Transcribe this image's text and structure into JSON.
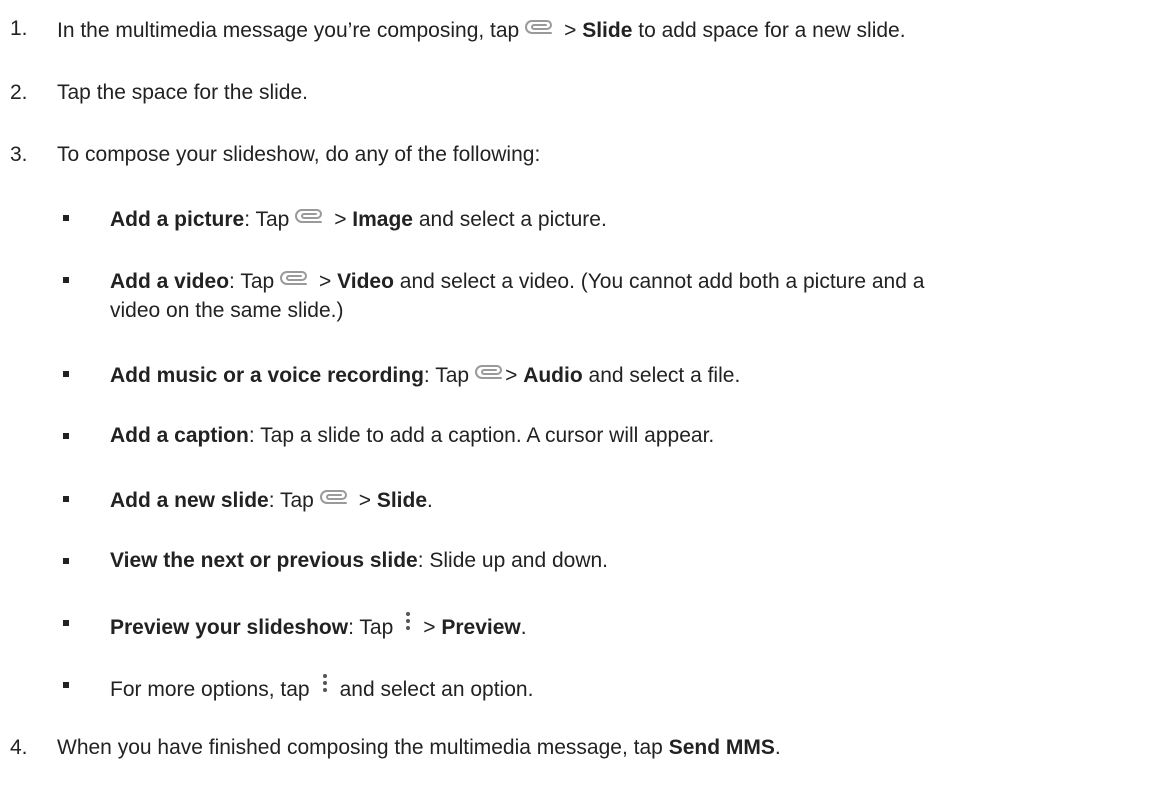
{
  "steps": [
    {
      "number": "1.",
      "pre": "In the multimedia message you’re composing, tap",
      "post": ">",
      "bold": "Slide",
      "tail": "to add space for a new slide.",
      "icon": "paperclip-icon"
    },
    {
      "number": "2.",
      "text": "Tap the space for the slide."
    },
    {
      "number": "3.",
      "text": "To compose your slideshow, do any of the following:"
    },
    {
      "number": "4.",
      "pre": "When you have finished composing the multimedia message, tap",
      "bold": "Send MMS",
      "tail": "."
    }
  ],
  "bullets": {
    "picture": {
      "label": "Add a picture",
      "colon": ": Tap",
      "after_icon": ">",
      "target": "Image",
      "tail": "and select a picture.",
      "icon": "paperclip-icon"
    },
    "video": {
      "label": "Add a video",
      "colon": ": Tap",
      "after_icon": ">",
      "target": "Video",
      "tail": "and select a video. (You cannot add both a picture and a",
      "tail2": "video on the same slide.)",
      "icon": "paperclip-icon"
    },
    "audio": {
      "label": "Add music or a voice recording",
      "colon": ": Tap",
      "after_icon": ">",
      "target": "Audio",
      "tail": "and select a file.",
      "icon": "paperclip-icon"
    },
    "caption": {
      "label": "Add a caption",
      "text": ": Tap a slide to add a caption. A cursor will appear."
    },
    "new_slide": {
      "label": "Add a new slide",
      "colon": ": Tap",
      "after_icon": ">",
      "target": "Slide",
      "tail": ".",
      "icon": "paperclip-icon"
    },
    "next_prev": {
      "label": "View the next or previous slide",
      "text": ": Slide up and down."
    },
    "preview": {
      "label": "Preview your slideshow",
      "colon": ": Tap",
      "after_icon": ">",
      "target": "Preview",
      "tail": ".",
      "icon": "more-vertical-icon"
    },
    "more": {
      "pre": "For more options, tap",
      "tail": "and select an option.",
      "icon": "more-vertical-icon"
    }
  }
}
